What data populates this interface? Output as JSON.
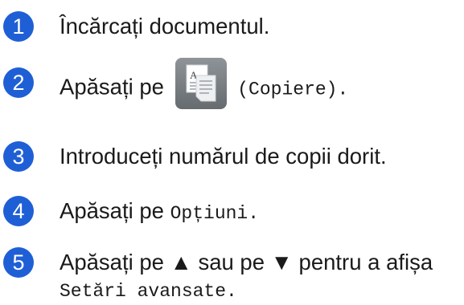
{
  "steps": [
    {
      "number": "1",
      "text": "Încărcați documentul."
    },
    {
      "number": "2",
      "prefix": "Apăsați pe",
      "button_label": "(Copiere).",
      "icon": "copy-icon"
    },
    {
      "number": "3",
      "text": "Introduceți numărul de copii dorit."
    },
    {
      "number": "4",
      "prefix": "Apăsați pe",
      "code": "Opțiuni."
    },
    {
      "number": "5",
      "prefix": "Apăsați pe ▲ sau pe ▼ pentru a afișa",
      "code": "Setări avansate."
    }
  ],
  "colors": {
    "accent": "#1f5fd6"
  }
}
